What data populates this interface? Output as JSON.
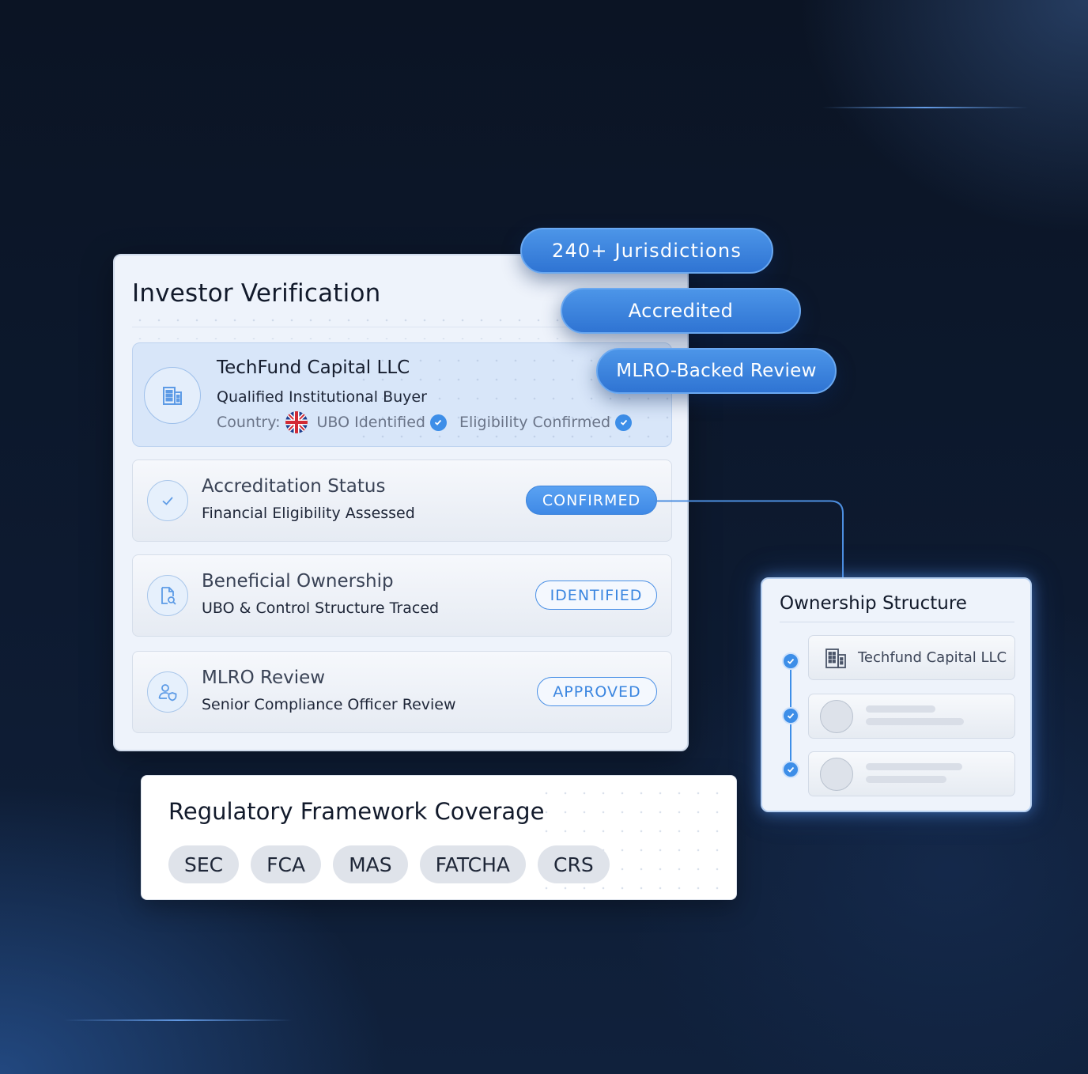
{
  "investor_card": {
    "title": "Investor Verification",
    "entity": {
      "name": "TechFund Capital LLC",
      "type": "Qualified Institutional Buyer",
      "country_label": "Country:",
      "ubo_label": "UBO Identified",
      "eligibility_label": "Eligibility Confirmed",
      "icon": "building-icon",
      "flag": "uk-flag-icon"
    },
    "rows": [
      {
        "title": "Accreditation Status",
        "subtitle": "Financial Eligibility Assessed",
        "status": "CONFIRMED",
        "icon": "check-icon"
      },
      {
        "title": "Beneficial Ownership",
        "subtitle": "UBO & Control Structure Traced",
        "status": "IDENTIFIED",
        "icon": "document-search-icon"
      },
      {
        "title": "MLRO Review",
        "subtitle": "Senior Compliance Officer Review",
        "status": "APPROVED",
        "icon": "user-shield-icon"
      }
    ]
  },
  "tags": [
    "240+ Jurisdictions",
    "Accredited",
    "MLRO-Backed Review"
  ],
  "ownership": {
    "title": "Ownership Structure",
    "top_entity": "Techfund Capital LLC"
  },
  "regulatory": {
    "title": "Regulatory Framework Coverage",
    "frameworks": [
      "SEC",
      "FCA",
      "MAS",
      "FATCHA",
      "CRS"
    ]
  },
  "colors": {
    "accent": "#3d8ee8",
    "tag_blue": "#2f74d3",
    "background": "#0c1628"
  }
}
